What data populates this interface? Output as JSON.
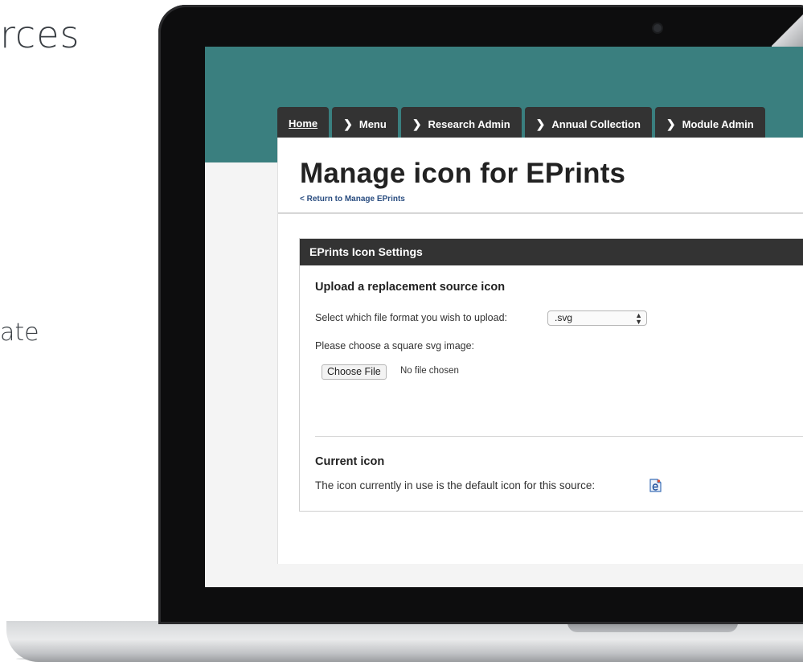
{
  "slide": {
    "title_fragment": "rces",
    "text_fragment": "ate"
  },
  "nav": {
    "tabs": [
      {
        "label": "Home",
        "chevron": ""
      },
      {
        "label": "Menu",
        "chevron": "❯"
      },
      {
        "label": "Research Admin",
        "chevron": "❯"
      },
      {
        "label": "Annual Collection",
        "chevron": "❯"
      },
      {
        "label": "Module Admin",
        "chevron": "❯"
      }
    ]
  },
  "page": {
    "title": "Manage icon for EPrints",
    "return_link": "< Return to Manage EPrints"
  },
  "panel": {
    "header": "EPrints Icon Settings",
    "upload": {
      "heading": "Upload a replacement source icon",
      "format_label": "Select which file format you wish to upload:",
      "format_value": ".svg",
      "choose_prompt": "Please choose a square svg image:",
      "choose_button": "Choose File",
      "file_status": "No file chosen"
    },
    "current": {
      "heading": "Current icon",
      "text": "The icon currently in use is the default icon for this source:",
      "icon": "eprints-icon"
    }
  },
  "colors": {
    "teal_band": "#3a7f7f",
    "tab_bg": "#333333",
    "link": "#2a4d80",
    "screen_bg": "#f4f4f4"
  }
}
